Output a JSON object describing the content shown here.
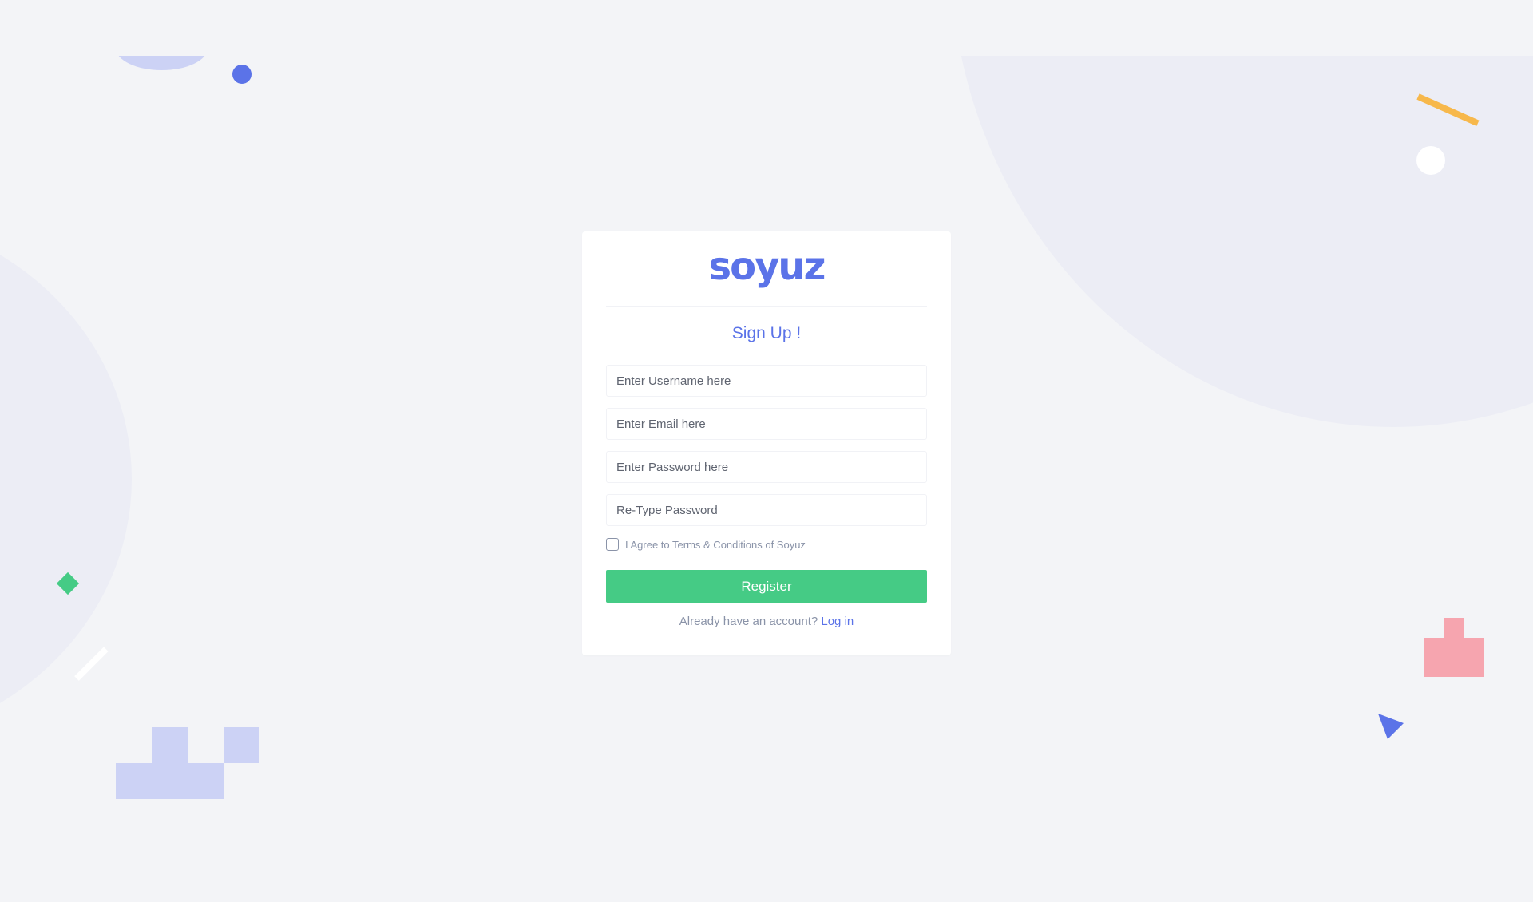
{
  "brand": {
    "logo_text": "soyuz"
  },
  "form": {
    "title": "Sign Up !",
    "username_placeholder": "Enter Username here",
    "email_placeholder": "Enter Email here",
    "password_placeholder": "Enter Password here",
    "retype_placeholder": "Re-Type Password",
    "agree_label": "I Agree to Terms & Conditions of Soyuz",
    "agree_checked": false,
    "register_label": "Register",
    "login_prompt": "Already have an account?",
    "login_link": "Log in"
  },
  "colors": {
    "background": "#f3f4f7",
    "primary": "#5b73e8",
    "success": "#45cb85",
    "muted_text": "#8a93a8",
    "card": "#ffffff",
    "accent_yellow": "#f7b84b",
    "accent_pink": "#f6a5af",
    "accent_lavender": "#ccd2f5"
  },
  "decorations": [
    "half-circle-shape",
    "dot-shape",
    "bar-shape",
    "diamond-shape",
    "block-shape",
    "triangle-shape",
    "background-circle"
  ]
}
